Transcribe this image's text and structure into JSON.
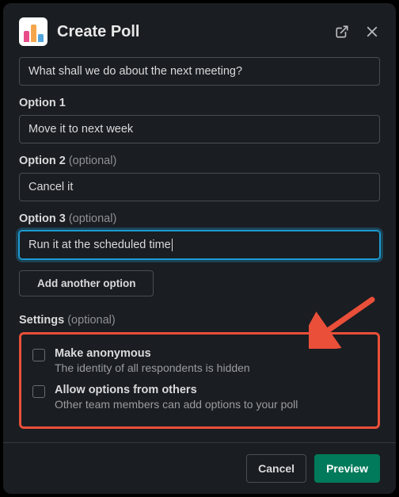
{
  "header": {
    "title": "Create Poll"
  },
  "form": {
    "question_value": "What shall we do about the next meeting?",
    "options": [
      {
        "label": "Option 1",
        "optional": "",
        "value": "Move it to next week",
        "focused": false
      },
      {
        "label": "Option 2",
        "optional": " (optional)",
        "value": "Cancel it",
        "focused": false
      },
      {
        "label": "Option 3",
        "optional": " (optional)",
        "value": "Run it at the scheduled time",
        "focused": true
      }
    ],
    "add_option_label": "Add another option"
  },
  "settings": {
    "heading": "Settings",
    "heading_optional": " (optional)",
    "items": [
      {
        "title": "Make anonymous",
        "desc": "The identity of all respondents is hidden"
      },
      {
        "title": "Allow options from others",
        "desc": "Other team members can add options to your poll"
      }
    ]
  },
  "footer": {
    "cancel": "Cancel",
    "preview": "Preview"
  }
}
